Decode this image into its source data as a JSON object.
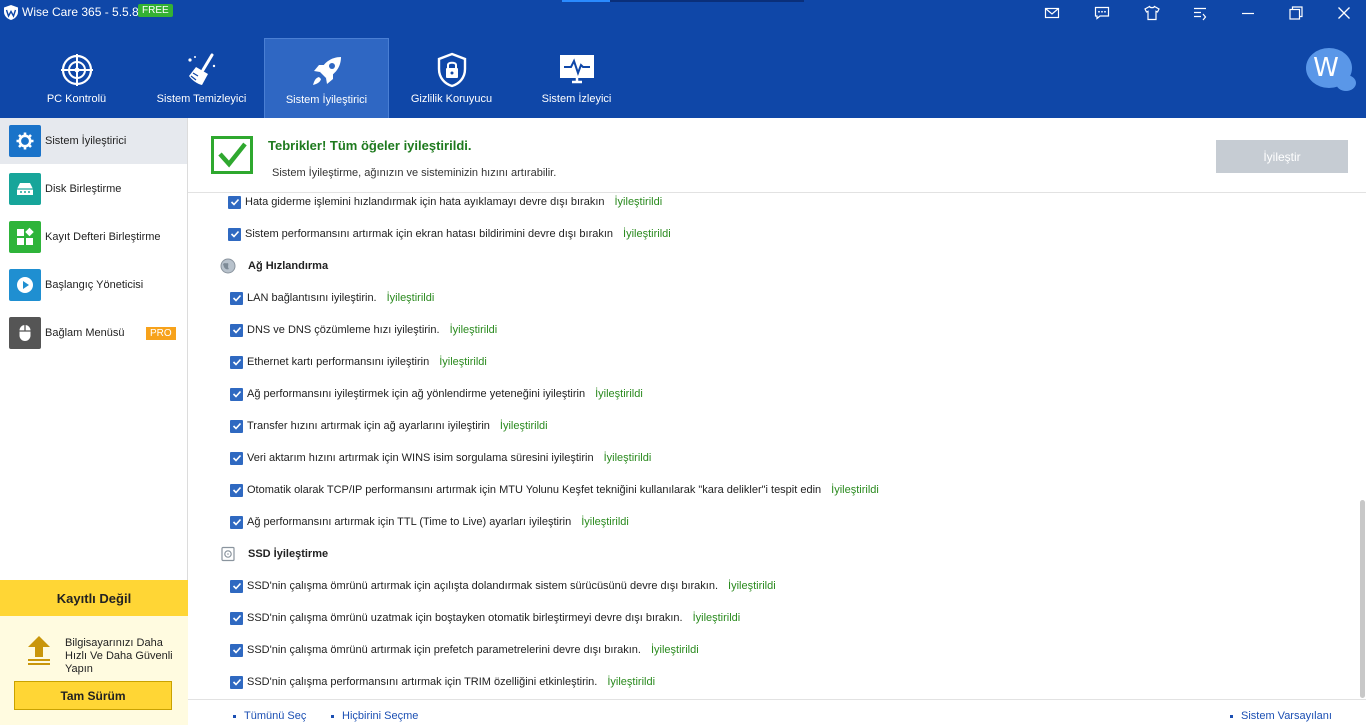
{
  "app": {
    "title": "Wise Care 365 - 5.5.8",
    "badge": "FREE"
  },
  "nav": {
    "tabs": [
      {
        "label": "PC Kontrolü",
        "icon": "pc-check-icon"
      },
      {
        "label": "Sistem Temizleyici",
        "icon": "broom-icon"
      },
      {
        "label": "Sistem İyileştirici",
        "icon": "rocket-icon"
      },
      {
        "label": "Gizlilik Koruyucu",
        "icon": "lock-shield-icon"
      },
      {
        "label": "Sistem İzleyici",
        "icon": "monitor-icon"
      }
    ],
    "active_tab": "Sistem İyileştirici",
    "avatar_letter": "W"
  },
  "sidebar": {
    "items": [
      {
        "label": "Sistem İyileştirici",
        "icon": "gear-icon",
        "color": "#1a73c9"
      },
      {
        "label": "Disk Birleştirme",
        "icon": "disk-icon",
        "color": "#17a59a"
      },
      {
        "label": "Kayıt Defteri Birleştirme",
        "icon": "registry-icon",
        "color": "#2eb43a"
      },
      {
        "label": "Başlangıç Yöneticisi",
        "icon": "play-icon",
        "color": "#1f8fd1"
      },
      {
        "label": "Bağlam Menüsü",
        "icon": "mouse-icon",
        "color": "#555555",
        "badge": "PRO"
      }
    ],
    "register": {
      "title": "Kayıtlı Değil",
      "text": "Bilgisayarınızı Daha Hızlı Ve Daha Güvenli Yapın",
      "button": "Tam Sürüm"
    }
  },
  "header": {
    "title": "Tebrikler! Tüm öğeler iyileştirildi.",
    "subtitle": "Sistem İyileştirme, ağınızın ve sisteminizin hızını artırabilir.",
    "button": "İyileştir"
  },
  "status_label": "İyileştirildi",
  "list": {
    "top_items": [
      "Hata giderme işlemini hızlandırmak için hata ayıklamayı devre dışı bırakın",
      "Sistem performansını artırmak için ekran hatası bildirimini devre dışı bırakın"
    ],
    "network": {
      "title": "Ağ Hızlandırma",
      "items": [
        "LAN bağlantısını iyileştirin.",
        "DNS ve DNS çözümleme hızı iyileştirin.",
        "Ethernet kartı performansını iyileştirin",
        "Ağ performansını iyileştirmek için ağ yönlendirme yeteneğini iyileştirin",
        "Transfer hızını artırmak için ağ ayarlarını iyileştirin",
        "Veri aktarım hızını artırmak için WINS isim sorgulama süresini iyileştirin",
        "Otomatik olarak TCP/IP performansını artırmak için MTU Yolunu Keşfet tekniğini kullanılarak \"kara delikler\"i tespit edin",
        "Ağ performansını artırmak için TTL (Time to Live) ayarları iyileştirin"
      ]
    },
    "ssd": {
      "title": "SSD İyileştirme",
      "items": [
        "SSD'nin çalışma ömrünü artırmak için açılışta dolandırmak sistem sürücüsünü devre dışı bırakın.",
        "SSD'nin çalışma ömrünü uzatmak için boştayken otomatik birleştirmeyi devre dışı bırakın.",
        "SSD'nin çalışma ömrünü artırmak için prefetch parametrelerini devre dışı bırakın.",
        "SSD'nin çalışma performansını artırmak için TRIM özelliğini etkinleştirin."
      ]
    }
  },
  "footer": {
    "select_all": "Tümünü Seç",
    "select_none": "Hiçbirini Seçme",
    "defaults": "Sistem Varsayılanı"
  }
}
